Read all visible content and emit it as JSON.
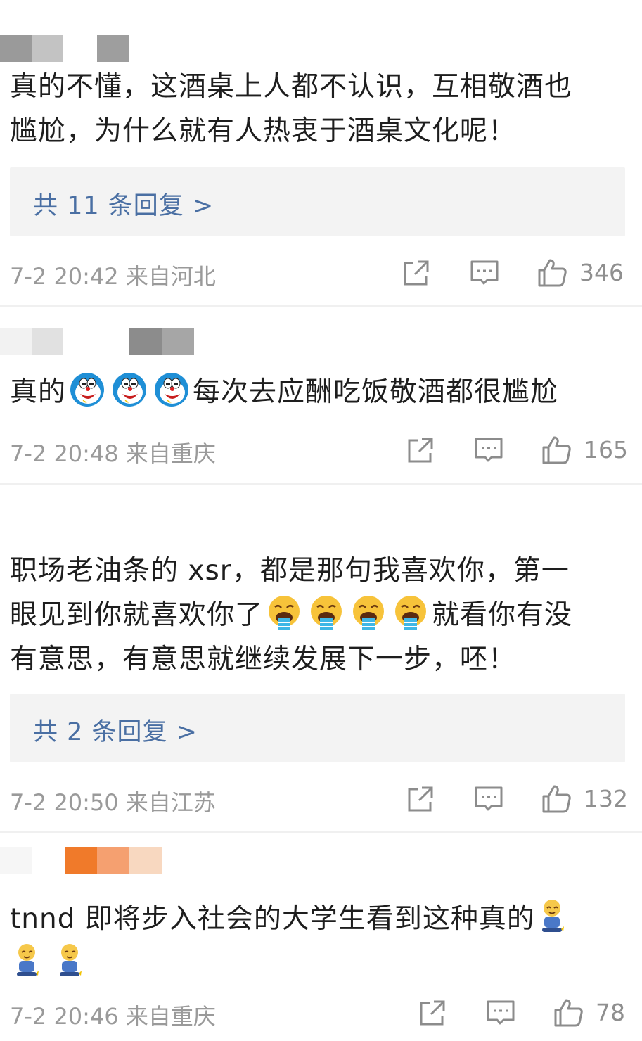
{
  "comments": [
    {
      "text_lines": [
        "真的不懂，这酒桌上人都不认识，互相敬酒也",
        "尴尬，为什么就有人热衷于酒桌文化呢！"
      ],
      "replies_label": "共 11 条回复 >",
      "time": "7-2 20:42 来自河北",
      "likes": "346"
    },
    {
      "text_prefix": "真的",
      "emoji": "doraemon-crying-emoji",
      "emoji_count": 3,
      "text_suffix": "每次去应酬吃饭敬酒都很尴尬",
      "time": "7-2 20:48 来自重庆",
      "likes": "165"
    },
    {
      "text_line1": "职场老油条的 xsr，都是那句我喜欢你，第一",
      "text_line2_prefix": "眼见到你就喜欢你了",
      "emoji": "vomiting-face-emoji",
      "emoji_count": 4,
      "text_line2_suffix": "就看你有没",
      "text_line3": "有意思，有意思就继续发展下一步，呸！",
      "replies_label": "共 2 条回复 >",
      "time": "7-2 20:50 来自江苏",
      "likes": "132"
    },
    {
      "text_line1": "tnnd 即将步入社会的大学生看到这种真的",
      "emoji": "kneeling-person-emoji",
      "emoji_count": 3,
      "time": "7-2 20:46 来自重庆",
      "likes": "78"
    }
  ],
  "colors": {
    "reply_link": "#4a6fa3",
    "meta_text": "#9a9a9a",
    "reply_bg": "#f3f3f3"
  }
}
